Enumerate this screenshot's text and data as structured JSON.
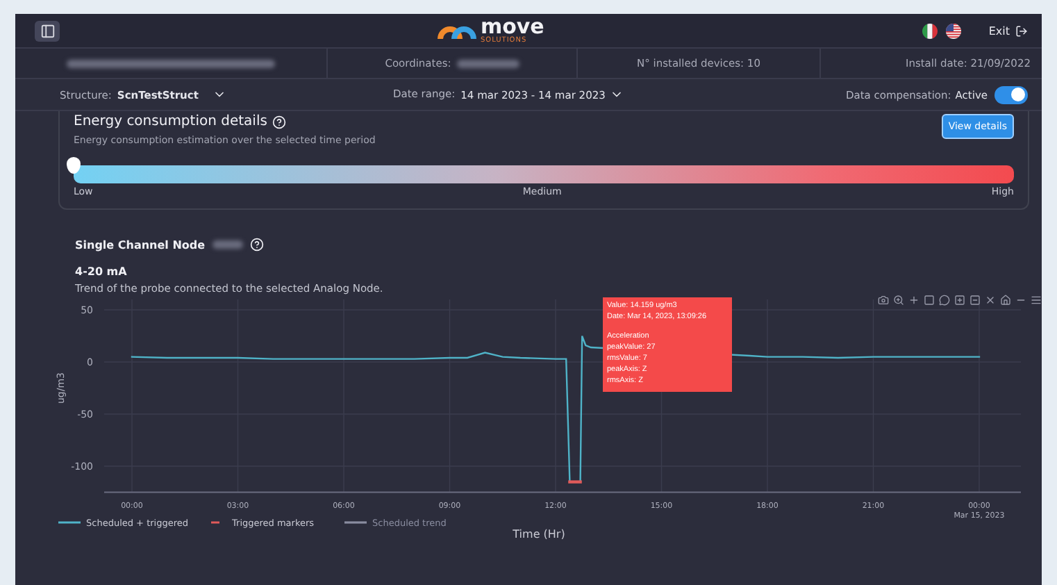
{
  "header": {
    "logo_text": "move",
    "logo_subtext": "SOLUTIONS",
    "exit_label": "Exit"
  },
  "info_bar": {
    "coordinates_label": "Coordinates:",
    "devices": "N° installed devices: 10",
    "install_date": "Install date: 21/09/2022"
  },
  "filters": {
    "structure_label": "Structure:",
    "structure_value": "ScnTestStruct",
    "date_range_label": "Date range:",
    "date_range_value": "14 mar 2023 - 14 mar 2023",
    "compensation_label": "Data compensation:",
    "compensation_value": "Active",
    "compensation_on": true
  },
  "energy": {
    "title": "Energy consumption details",
    "subtitle": "Energy consumption estimation over the selected time period",
    "button": "View details",
    "level": 0,
    "scale": [
      "Low",
      "Medium",
      "High"
    ]
  },
  "node": {
    "title": "Single Channel Node",
    "subtitle": "4-20 mA",
    "description": "Trend of the probe connected to the selected Analog Node.",
    "chart_data": {
      "type": "line",
      "xlabel": "Time (Hr)",
      "ylabel": "ug/m3",
      "grid": true,
      "x": [
        0,
        1,
        2,
        3,
        4,
        5,
        6,
        7,
        8,
        9,
        9.5,
        10,
        10.5,
        11,
        12,
        12.3,
        12.4,
        12.7,
        12.75,
        12.85,
        13,
        17.5,
        18,
        19,
        20,
        21,
        22,
        23,
        24
      ],
      "series": [
        {
          "name": "Scheduled + triggered",
          "color": "#4fb3c8",
          "values": [
            5,
            4,
            4,
            4,
            3,
            3,
            3,
            3,
            3,
            4,
            4,
            9,
            5,
            4,
            3,
            3,
            -115,
            -115,
            25,
            16,
            14,
            6,
            5,
            5,
            4,
            5,
            5,
            5,
            5
          ]
        },
        {
          "name": "Triggered markers",
          "color": "#e05a5a",
          "values": [
            null,
            null,
            null,
            null,
            null,
            null,
            null,
            null,
            null,
            null,
            null,
            null,
            null,
            null,
            null,
            null,
            -115,
            -115,
            null,
            null,
            null,
            null,
            null,
            null,
            null,
            null,
            null,
            null,
            null
          ]
        }
      ],
      "xlim": [
        0,
        24
      ],
      "ylim": [
        -125,
        60
      ],
      "legend": "bottom",
      "xticks": [
        {
          "value": 0,
          "label": "00:00"
        },
        {
          "value": 3,
          "label": "03:00"
        },
        {
          "value": 6,
          "label": "06:00"
        },
        {
          "value": 9,
          "label": "09:00"
        },
        {
          "value": 12,
          "label": "12:00"
        },
        {
          "value": 15,
          "label": "15:00"
        },
        {
          "value": 18,
          "label": "18:00"
        },
        {
          "value": 21,
          "label": "21:00"
        },
        {
          "value": 24,
          "label": "00:00"
        }
      ],
      "yticks": [
        50,
        0,
        -50,
        -100
      ]
    },
    "date_marker": "Mar 15, 2023",
    "legend_extra": {
      "label": "Scheduled trend",
      "color": "#8a8da0"
    },
    "tooltip": {
      "value": "Value: 14.159 ug/m3",
      "date": "Date: Mar 14, 2023, 13:09:26",
      "heading": "Acceleration",
      "lines": [
        "peakValue: 27",
        "rmsValue: 7",
        "peakAxis: Z",
        "rmsAxis: Z"
      ]
    }
  }
}
